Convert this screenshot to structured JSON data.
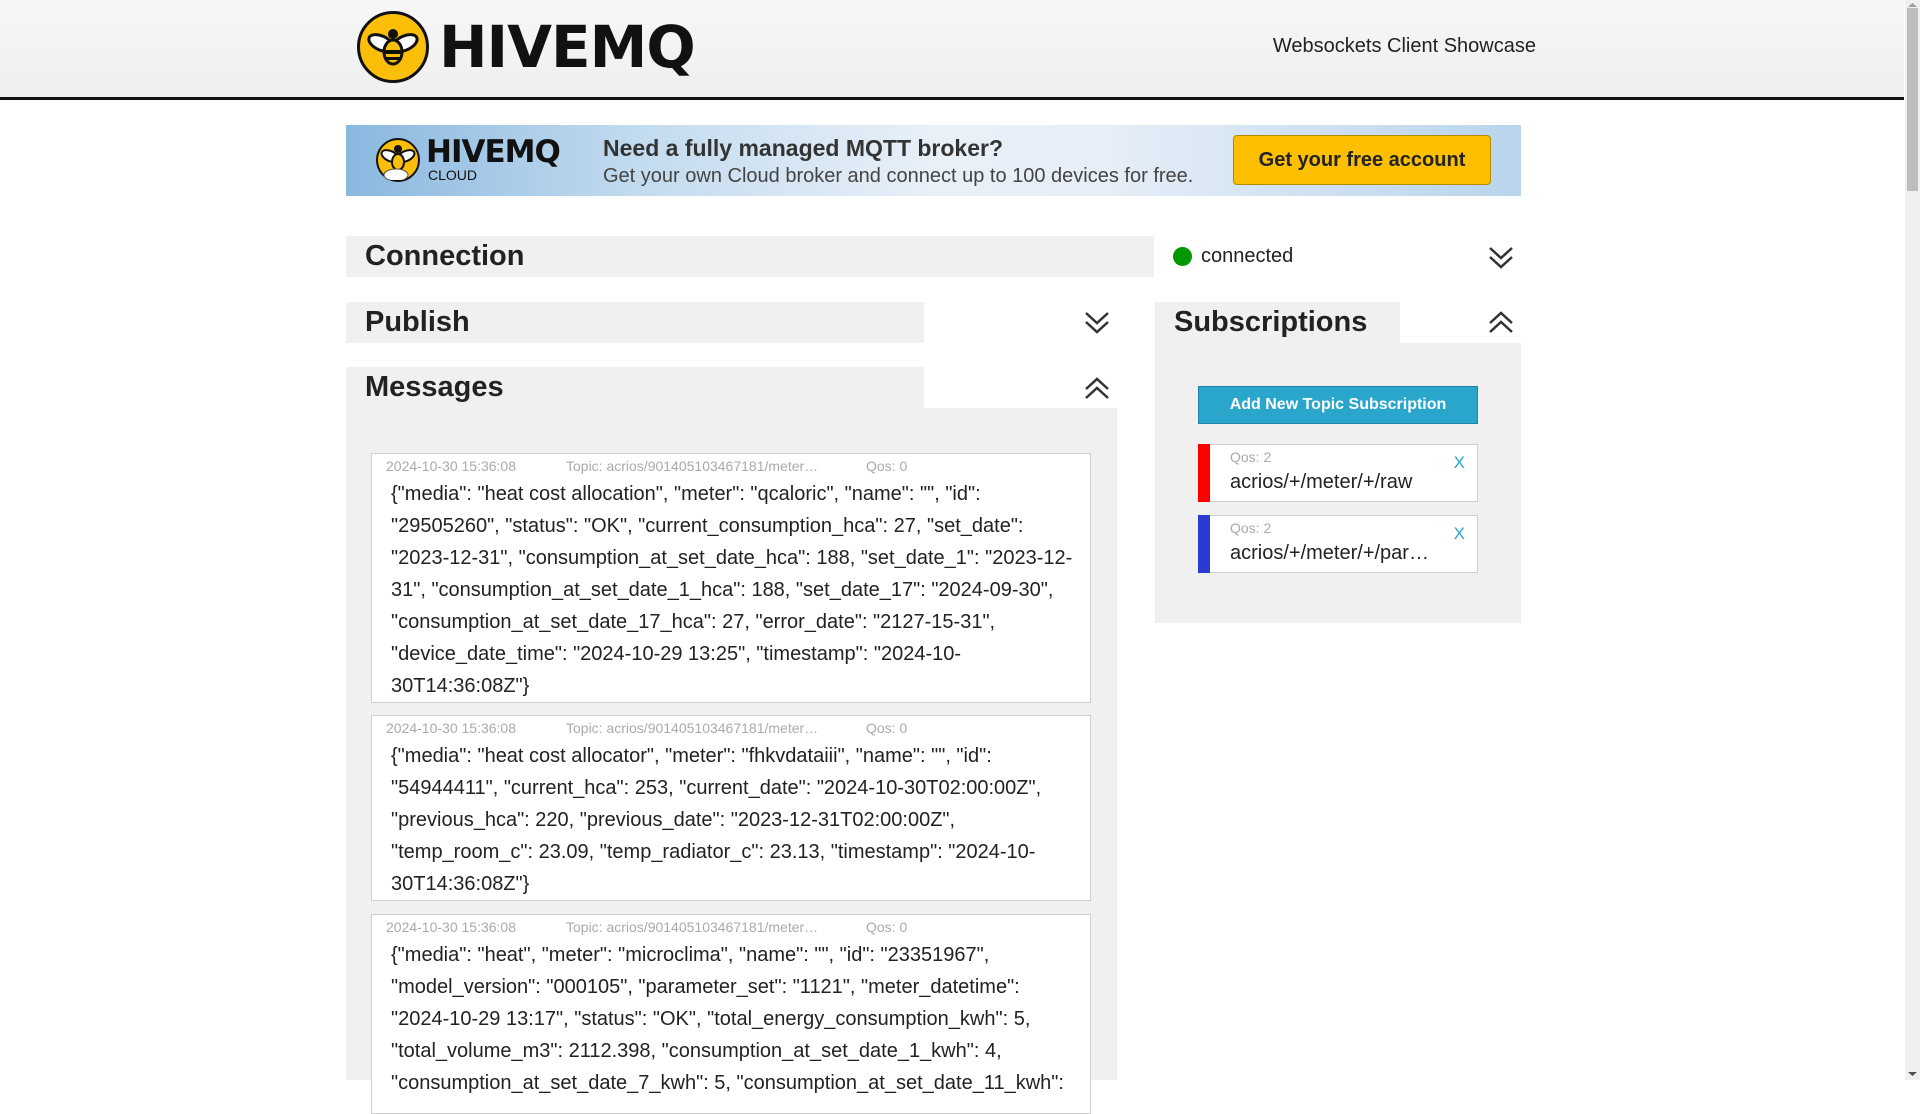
{
  "header": {
    "logo_text": "HIVEMQ",
    "title": "Websockets Client Showcase"
  },
  "banner": {
    "logo_text": "HIVEMQ",
    "logo_sub": "CLOUD",
    "title": "Need a fully managed MQTT broker?",
    "subtitle": "Get your own Cloud broker and connect up to 100 devices for free.",
    "cta_label": "Get your free account"
  },
  "connection": {
    "title": "Connection",
    "status": "connected",
    "status_color": "#029802",
    "expanded": false
  },
  "publish": {
    "title": "Publish",
    "expanded": false
  },
  "messages": {
    "title": "Messages",
    "expanded": true,
    "items": [
      {
        "time": "2024-10-30 15:36:08",
        "topic": "Topic: acrios/901405103467181/meter…",
        "qos": "Qos: 0",
        "payload": "{\"media\": \"heat cost allocation\", \"meter\": \"qcaloric\", \"name\": \"\", \"id\": \"29505260\", \"status\": \"OK\", \"current_consumption_hca\": 27, \"set_date\": \"2023-12-31\", \"consumption_at_set_date_hca\": 188, \"set_date_1\": \"2023-12-31\", \"consumption_at_set_date_1_hca\": 188, \"set_date_17\": \"2024-09-30\", \"consumption_at_set_date_17_hca\": 27, \"error_date\": \"2127-15-31\", \"device_date_time\": \"2024-10-29 13:25\", \"timestamp\": \"2024-10-30T14:36:08Z\"}",
        "color": "#ff0000"
      },
      {
        "time": "2024-10-30 15:36:08",
        "topic": "Topic: acrios/901405103467181/meter…",
        "qos": "Qos: 0",
        "payload": "{\"media\": \"heat cost allocator\", \"meter\": \"fhkvdataiii\", \"name\": \"\", \"id\": \"54944411\", \"current_hca\": 253, \"current_date\": \"2024-10-30T02:00:00Z\", \"previous_hca\": 220, \"previous_date\": \"2023-12-31T02:00:00Z\", \"temp_room_c\": 23.09, \"temp_radiator_c\": 23.13, \"timestamp\": \"2024-10-30T14:36:08Z\"}"
      },
      {
        "time": "2024-10-30 15:36:08",
        "topic": "Topic: acrios/901405103467181/meter…",
        "qos": "Qos: 0",
        "payload": "{\"media\": \"heat\", \"meter\": \"microclima\", \"name\": \"\", \"id\": \"23351967\", \"model_version\": \"000105\", \"parameter_set\": \"1121\", \"meter_datetime\": \"2024-10-29 13:17\", \"status\": \"OK\", \"total_energy_consumption_kwh\": 5, \"total_volume_m3\": 2112.398, \"consumption_at_set_date_1_kwh\": 4, \"consumption_at_set_date_7_kwh\": 5, \"consumption_at_set_date_11_kwh\":"
      }
    ]
  },
  "subscriptions": {
    "title": "Subscriptions",
    "expanded": true,
    "add_label": "Add New Topic Subscription",
    "items": [
      {
        "qos": "Qos: 2",
        "topic": "acrios/+/meter/+/raw",
        "color": "#ff0000",
        "remove": "X"
      },
      {
        "qos": "Qos: 2",
        "topic": "acrios/+/meter/+/parsed",
        "color": "#2b3bd1",
        "remove": "X"
      }
    ]
  }
}
